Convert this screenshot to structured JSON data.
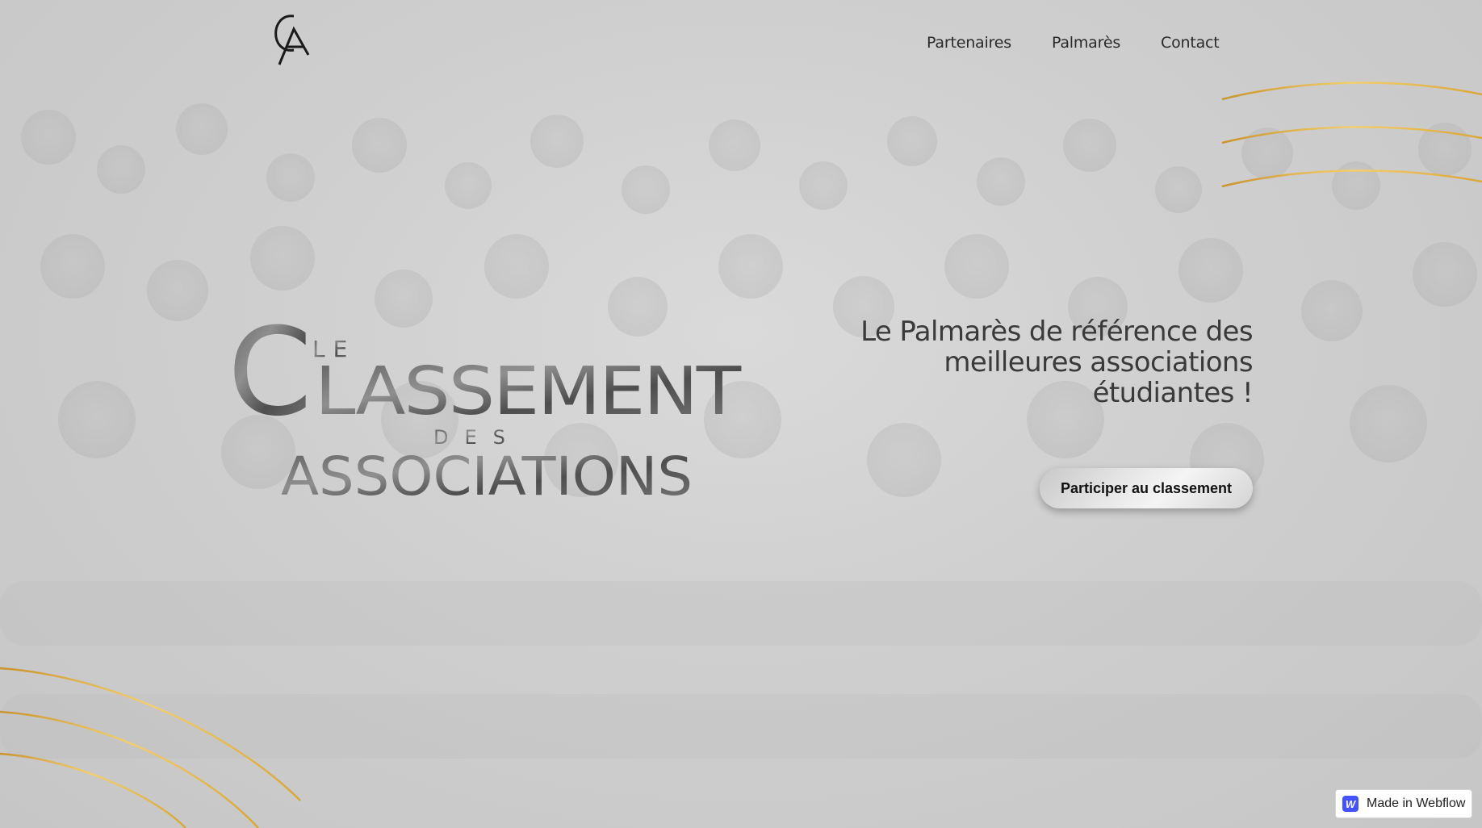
{
  "header": {
    "logo_text": "CA",
    "nav": [
      {
        "label": "Partenaires"
      },
      {
        "label": "Palmarès"
      },
      {
        "label": "Contact"
      }
    ]
  },
  "hero": {
    "brand": {
      "le": "LE",
      "classement": "CLASSEMENT",
      "des": "DES",
      "associations": "ASSOCIATIONS"
    },
    "tagline": "Le Palmarès de référence des meilleures associations étudiantes !",
    "cta_label": "Participer au classement"
  },
  "badge": {
    "icon": "webflow-icon",
    "icon_letter": "W",
    "label": "Made in Webflow"
  },
  "colors": {
    "gold": "#d9a63a",
    "text_dark": "#2a2a2a",
    "webflow_blue": "#4353ff"
  }
}
